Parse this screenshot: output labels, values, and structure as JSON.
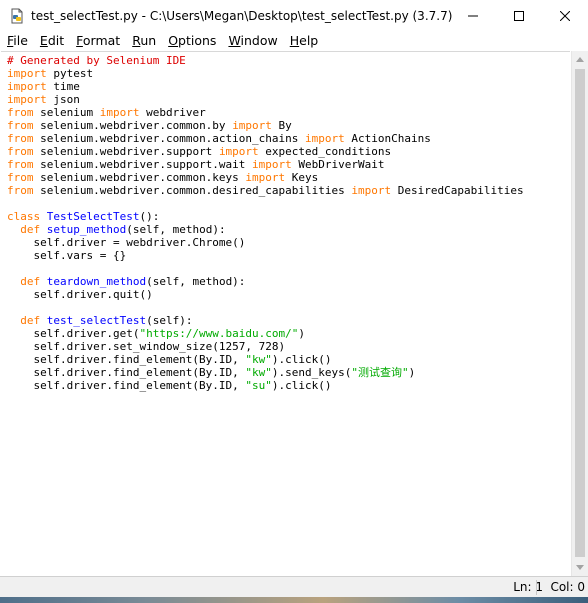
{
  "window": {
    "title": "test_selectTest.py - C:\\Users\\Megan\\Desktop\\test_selectTest.py (3.7.7)",
    "icon": "python-file-icon",
    "controls": [
      "minimize",
      "maximize",
      "close"
    ]
  },
  "menu": [
    {
      "label": "File",
      "key": "F",
      "rest": "ile"
    },
    {
      "label": "Edit",
      "key": "E",
      "rest": "dit"
    },
    {
      "label": "Format",
      "key": "F",
      "rest": "ormat"
    },
    {
      "label": "Run",
      "key": "R",
      "rest": "un"
    },
    {
      "label": "Options",
      "key": "O",
      "rest": "ptions"
    },
    {
      "label": "Window",
      "key": "W",
      "rest": "indow"
    },
    {
      "label": "Help",
      "key": "H",
      "rest": "elp"
    }
  ],
  "colors": {
    "keyword": "#ff7700",
    "comment": "#dd0000",
    "definition": "#0000ff",
    "string": "#00aa00"
  },
  "code_lines": [
    [
      [
        "cm",
        "# Generated by Selenium IDE"
      ]
    ],
    [
      [
        "kw",
        "import"
      ],
      [
        "",
        " pytest"
      ]
    ],
    [
      [
        "kw",
        "import"
      ],
      [
        "",
        " time"
      ]
    ],
    [
      [
        "kw",
        "import"
      ],
      [
        "",
        " json"
      ]
    ],
    [
      [
        "kw",
        "from"
      ],
      [
        "",
        " selenium "
      ],
      [
        "kw",
        "import"
      ],
      [
        "",
        " webdriver"
      ]
    ],
    [
      [
        "kw",
        "from"
      ],
      [
        "",
        " selenium.webdriver.common.by "
      ],
      [
        "kw",
        "import"
      ],
      [
        "",
        " By"
      ]
    ],
    [
      [
        "kw",
        "from"
      ],
      [
        "",
        " selenium.webdriver.common.action_chains "
      ],
      [
        "kw",
        "import"
      ],
      [
        "",
        " ActionChains"
      ]
    ],
    [
      [
        "kw",
        "from"
      ],
      [
        "",
        " selenium.webdriver.support "
      ],
      [
        "kw",
        "import"
      ],
      [
        "",
        " expected_conditions"
      ]
    ],
    [
      [
        "kw",
        "from"
      ],
      [
        "",
        " selenium.webdriver.support.wait "
      ],
      [
        "kw",
        "import"
      ],
      [
        "",
        " WebDriverWait"
      ]
    ],
    [
      [
        "kw",
        "from"
      ],
      [
        "",
        " selenium.webdriver.common.keys "
      ],
      [
        "kw",
        "import"
      ],
      [
        "",
        " Keys"
      ]
    ],
    [
      [
        "kw",
        "from"
      ],
      [
        "",
        " selenium.webdriver.common.desired_capabilities "
      ],
      [
        "kw",
        "import"
      ],
      [
        "",
        " DesiredCapabilities"
      ]
    ],
    [],
    [
      [
        "kw",
        "class"
      ],
      [
        "",
        " "
      ],
      [
        "df",
        "TestSelectTest"
      ],
      [
        "",
        "():"
      ]
    ],
    [
      [
        "",
        "  "
      ],
      [
        "kw",
        "def"
      ],
      [
        "",
        " "
      ],
      [
        "df",
        "setup_method"
      ],
      [
        "",
        "(self, method):"
      ]
    ],
    [
      [
        "",
        "    self.driver = webdriver.Chrome()"
      ]
    ],
    [
      [
        "",
        "    self.vars = {}"
      ]
    ],
    [],
    [
      [
        "",
        "  "
      ],
      [
        "kw",
        "def"
      ],
      [
        "",
        " "
      ],
      [
        "df",
        "teardown_method"
      ],
      [
        "",
        "(self, method):"
      ]
    ],
    [
      [
        "",
        "    self.driver.quit()"
      ]
    ],
    [],
    [
      [
        "",
        "  "
      ],
      [
        "kw",
        "def"
      ],
      [
        "",
        " "
      ],
      [
        "df",
        "test_selectTest"
      ],
      [
        "",
        "(self):"
      ]
    ],
    [
      [
        "",
        "    self.driver.get("
      ],
      [
        "st",
        "\"https://www.baidu.com/\""
      ],
      [
        "",
        ")"
      ]
    ],
    [
      [
        "",
        "    self.driver.set_window_size(1257, 728)"
      ]
    ],
    [
      [
        "",
        "    self.driver.find_element(By.ID, "
      ],
      [
        "st",
        "\"kw\""
      ],
      [
        "",
        ").click()"
      ]
    ],
    [
      [
        "",
        "    self.driver.find_element(By.ID, "
      ],
      [
        "st",
        "\"kw\""
      ],
      [
        "",
        ").send_keys("
      ],
      [
        "st",
        "\"测试查询\""
      ],
      [
        "",
        ")"
      ]
    ],
    [
      [
        "",
        "    self.driver.find_element(By.ID, "
      ],
      [
        "st",
        "\"su\""
      ],
      [
        "",
        ").click()"
      ]
    ]
  ],
  "status": {
    "line": "Ln: 1",
    "col": "Col: 0"
  }
}
